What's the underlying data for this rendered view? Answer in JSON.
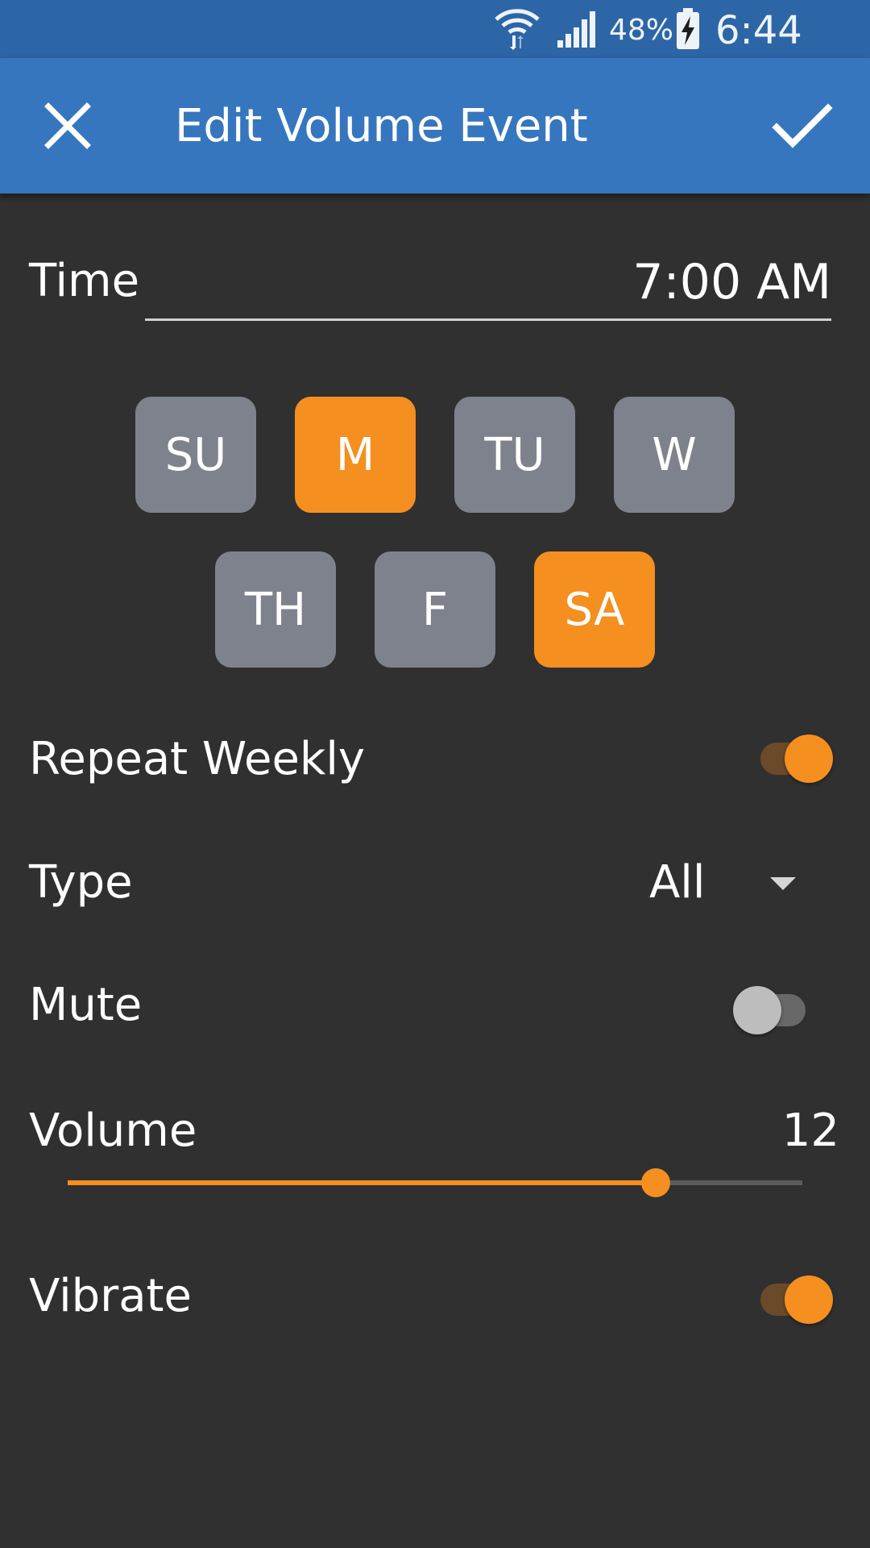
{
  "status_bar": {
    "battery_percent": "48%",
    "time": "6:44 PM",
    "icons": [
      "wifi-icon",
      "signal-icon",
      "battery-charging-icon"
    ]
  },
  "app_bar": {
    "title": "Edit Volume Event",
    "close_icon": "close-icon",
    "confirm_icon": "check-icon"
  },
  "form": {
    "time": {
      "label": "Time",
      "value": "7:00 AM"
    },
    "days": [
      {
        "label": "SU",
        "selected": false
      },
      {
        "label": "M",
        "selected": true
      },
      {
        "label": "TU",
        "selected": false
      },
      {
        "label": "W",
        "selected": false
      },
      {
        "label": "TH",
        "selected": false
      },
      {
        "label": "F",
        "selected": false
      },
      {
        "label": "SA",
        "selected": true
      }
    ],
    "repeat_weekly": {
      "label": "Repeat Weekly",
      "on": true
    },
    "type": {
      "label": "Type",
      "value": "All"
    },
    "mute": {
      "label": "Mute",
      "on": false
    },
    "volume": {
      "label": "Volume",
      "value": "12",
      "level_fraction": 0.8
    },
    "vibrate": {
      "label": "Vibrate",
      "on": true
    }
  },
  "colors": {
    "status_bar": "#2d66a6",
    "app_bar": "#3676bf",
    "background": "#303030",
    "accent": "#f48f20",
    "day_off": "#7e828c",
    "toggle_on_track": "#6b4a2a",
    "toggle_off_thumb": "#bdbdbd",
    "toggle_off_track": "#686868"
  }
}
